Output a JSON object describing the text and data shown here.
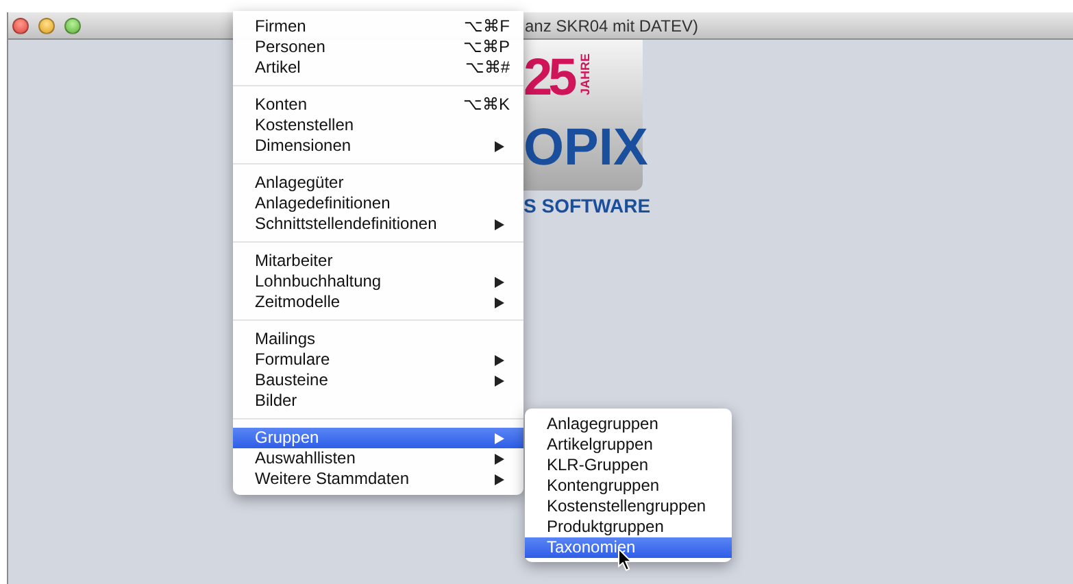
{
  "window": {
    "title": "anz SKR04 mit DATEV)"
  },
  "logo": {
    "number": "25",
    "tag": "JAHRE",
    "name": "OPIX",
    "subtitle": "S SOFTWARE"
  },
  "menu": {
    "groups": [
      [
        {
          "label": "Firmen",
          "shortcut": "⌥⌘F",
          "submenu": false,
          "selected": false
        },
        {
          "label": "Personen",
          "shortcut": "⌥⌘P",
          "submenu": false,
          "selected": false
        },
        {
          "label": "Artikel",
          "shortcut": "⌥⌘#",
          "submenu": false,
          "selected": false
        }
      ],
      [
        {
          "label": "Konten",
          "shortcut": "⌥⌘K",
          "submenu": false,
          "selected": false
        },
        {
          "label": "Kostenstellen",
          "submenu": false,
          "selected": false
        },
        {
          "label": "Dimensionen",
          "submenu": true,
          "selected": false
        }
      ],
      [
        {
          "label": "Anlagegüter",
          "submenu": false,
          "selected": false
        },
        {
          "label": "Anlagedefinitionen",
          "submenu": false,
          "selected": false
        },
        {
          "label": "Schnittstellendefinitionen",
          "submenu": true,
          "selected": false
        }
      ],
      [
        {
          "label": "Mitarbeiter",
          "submenu": false,
          "selected": false
        },
        {
          "label": "Lohnbuchhaltung",
          "submenu": true,
          "selected": false
        },
        {
          "label": "Zeitmodelle",
          "submenu": true,
          "selected": false
        }
      ],
      [
        {
          "label": "Mailings",
          "submenu": false,
          "selected": false
        },
        {
          "label": "Formulare",
          "submenu": true,
          "selected": false
        },
        {
          "label": "Bausteine",
          "submenu": true,
          "selected": false
        },
        {
          "label": "Bilder",
          "submenu": false,
          "selected": false
        }
      ],
      [
        {
          "label": "Gruppen",
          "submenu": true,
          "selected": true
        },
        {
          "label": "Auswahllisten",
          "submenu": true,
          "selected": false
        },
        {
          "label": "Weitere Stammdaten",
          "submenu": true,
          "selected": false
        }
      ]
    ]
  },
  "submenu": {
    "items": [
      {
        "label": "Anlagegruppen",
        "selected": false
      },
      {
        "label": "Artikelgruppen",
        "selected": false
      },
      {
        "label": "KLR-Gruppen",
        "selected": false
      },
      {
        "label": "Kontengruppen",
        "selected": false
      },
      {
        "label": "Kostenstellengruppen",
        "selected": false
      },
      {
        "label": "Produktgruppen",
        "selected": false
      },
      {
        "label": "Taxonomien",
        "selected": true
      }
    ]
  }
}
